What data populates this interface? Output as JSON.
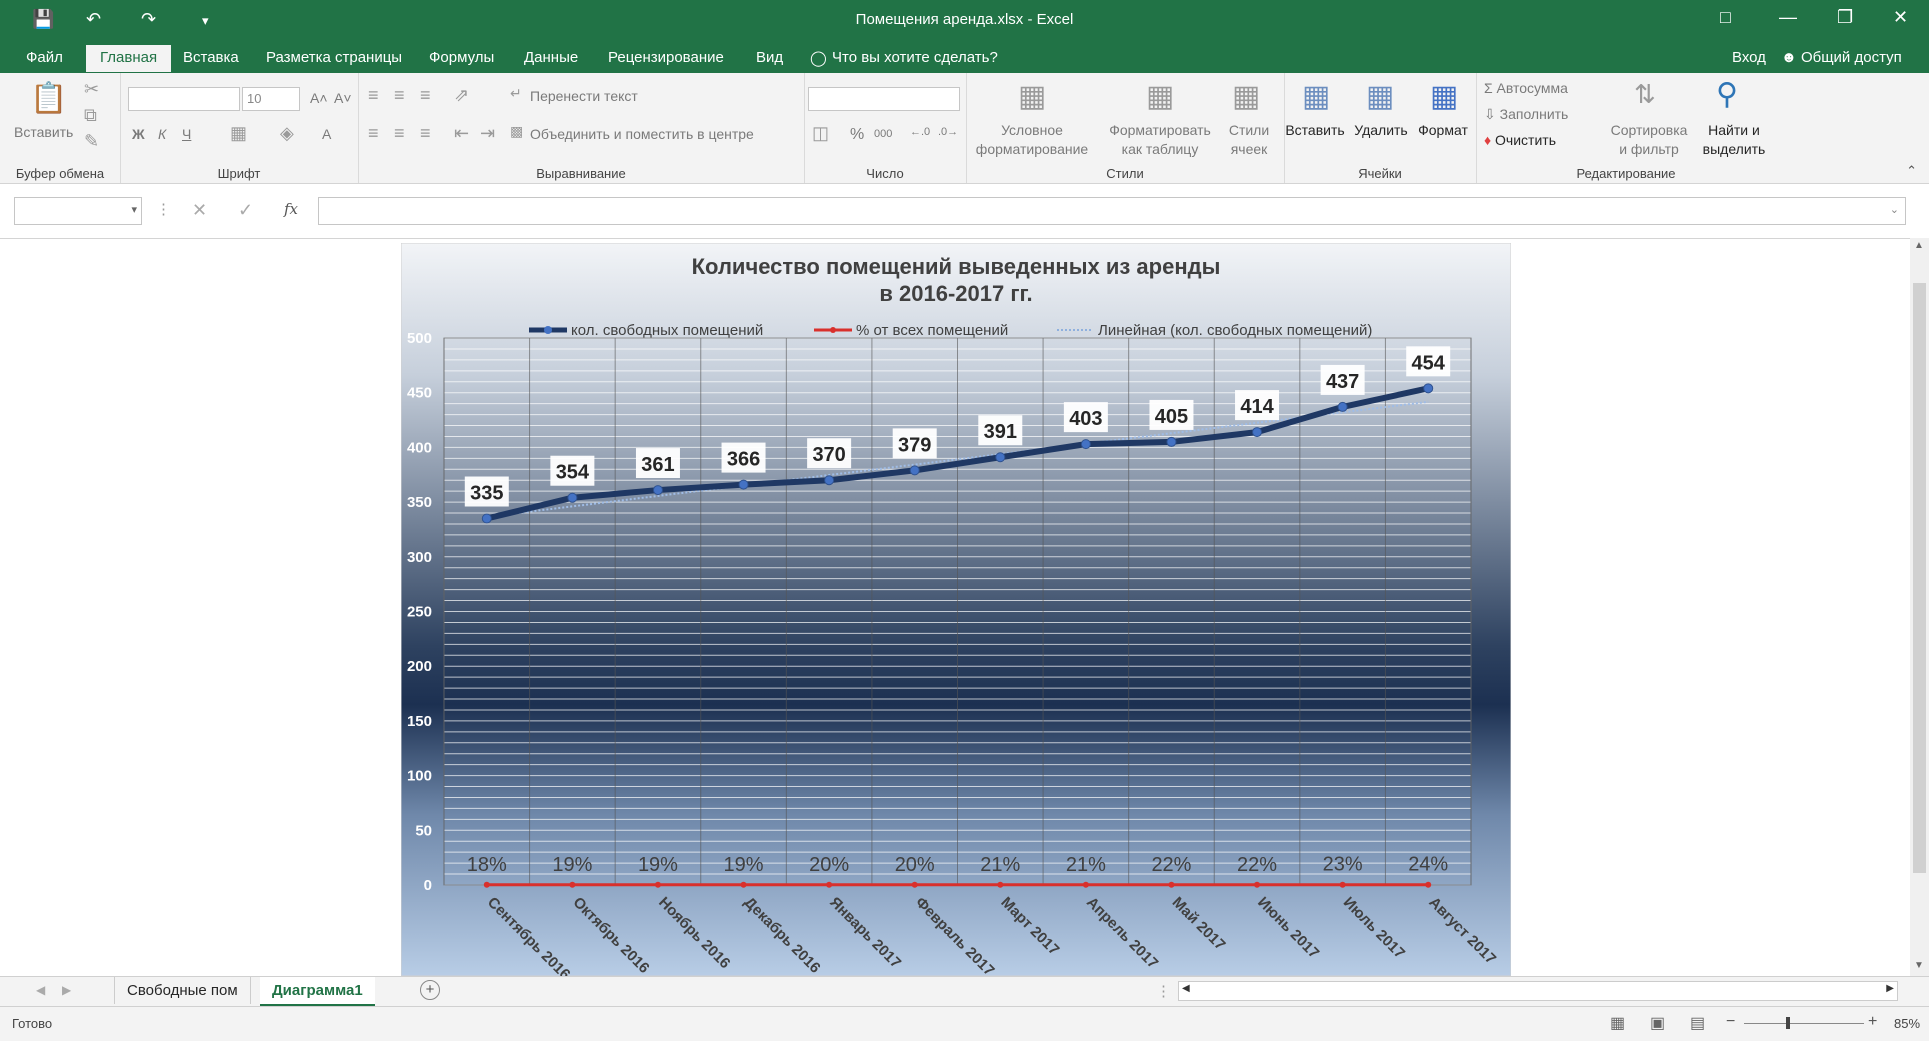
{
  "app": {
    "window_title": "Помещения аренда.xlsx - Excel",
    "signin_label": "Вход",
    "share_label": "Общий доступ"
  },
  "tabs": [
    {
      "label": "Файл"
    },
    {
      "label": "Главная"
    },
    {
      "label": "Вставка"
    },
    {
      "label": "Разметка страницы"
    },
    {
      "label": "Формулы"
    },
    {
      "label": "Данные"
    },
    {
      "label": "Рецензирование"
    },
    {
      "label": "Вид"
    }
  ],
  "tell_me": "Что вы хотите сделать?",
  "ribbon": {
    "clipboard": {
      "paste": "Вставить",
      "label": "Буфер обмена"
    },
    "font": {
      "size": "10",
      "bold": "Ж",
      "italic": "К",
      "underline": "Ч",
      "label": "Шрифт"
    },
    "alignment": {
      "wrap": "Перенести текст",
      "merge": "Объединить и поместить в центре",
      "label": "Выравнивание"
    },
    "number": {
      "label": "Число",
      "percent": "%",
      "thousands": "000"
    },
    "styles": {
      "conditional_1": "Условное",
      "conditional_2": "форматирование",
      "format_table_1": "Форматировать",
      "format_table_2": "как таблицу",
      "cell_styles_1": "Стили",
      "cell_styles_2": "ячеек",
      "label": "Стили"
    },
    "cells": {
      "insert": "Вставить",
      "delete": "Удалить",
      "format": "Формат",
      "label": "Ячейки"
    },
    "editing": {
      "autosum": "Автосумма",
      "fill": "Заполнить",
      "clear": "Очистить",
      "sort_1": "Сортировка",
      "sort_2": "и фильтр",
      "find_1": "Найти и",
      "find_2": "выделить",
      "label": "Редактирование"
    }
  },
  "formula_bar": {
    "fx": "fx"
  },
  "sheets": [
    {
      "label": "Свободные пом"
    },
    {
      "label": "Диаграмма1"
    }
  ],
  "status": {
    "ready": "Готово",
    "zoom": "85%"
  },
  "chart_data": {
    "type": "line",
    "title_line1": "Количество помещений выведенных из аренды",
    "title_line2": "в 2016-2017 гг.",
    "categories": [
      "Сентябрь 2016",
      "Октябрь 2016",
      "Ноябрь 2016",
      "Декабрь 2016",
      "Январь 2017",
      "Февраль 2017",
      "Март 2017",
      "Апрель 2017",
      "Май 2017",
      "Июнь 2017",
      "Июль 2017",
      "Август 2017"
    ],
    "series": [
      {
        "name": "кол. свободных помещений",
        "values": [
          335,
          354,
          361,
          366,
          370,
          379,
          391,
          403,
          405,
          414,
          437,
          454
        ],
        "color": "#1f3864"
      },
      {
        "name": "% от всех помещений",
        "values": [
          0.18,
          0.19,
          0.19,
          0.19,
          0.2,
          0.2,
          0.21,
          0.21,
          0.22,
          0.22,
          0.23,
          0.24
        ],
        "labels": [
          "18%",
          "19%",
          "19%",
          "19%",
          "20%",
          "20%",
          "21%",
          "21%",
          "22%",
          "22%",
          "23%",
          "24%"
        ],
        "color": "#d9302c"
      }
    ],
    "trendline": {
      "name": "Линейная (кол. свободных помещений)"
    },
    "ylim": [
      0,
      500
    ],
    "yticks": [
      0,
      50,
      100,
      150,
      200,
      250,
      300,
      350,
      400,
      450,
      500
    ],
    "grid": true,
    "legend_position": "top"
  }
}
